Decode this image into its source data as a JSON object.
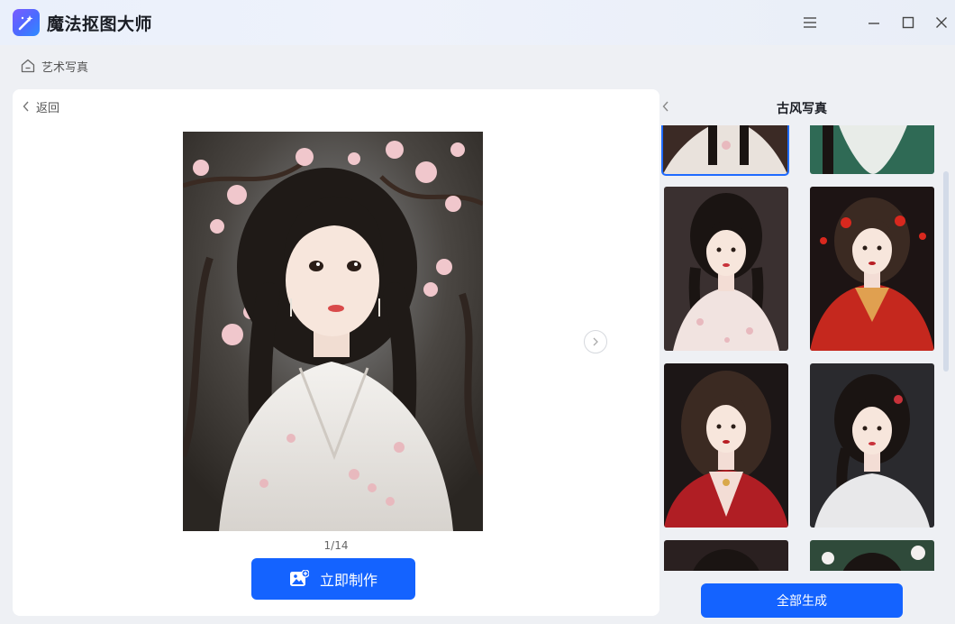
{
  "app": {
    "title": "魔法抠图大师"
  },
  "breadcrumb": {
    "label": "艺术写真"
  },
  "left": {
    "back_label": "返回",
    "page_indicator": "1/14",
    "make_button_label": "立即制作"
  },
  "right": {
    "title": "古风写真",
    "generate_all_label": "全部生成"
  },
  "gallery": {
    "items": [
      {
        "name": "portrait-1",
        "palette": [
          "#3b2a25",
          "#e9e2dc",
          "#1a1412"
        ]
      },
      {
        "name": "portrait-2",
        "palette": [
          "#2f6a55",
          "#e8ece8",
          "#1a1412"
        ]
      },
      {
        "name": "portrait-3",
        "palette": [
          "#3a3030",
          "#f1e3e0",
          "#1a1412"
        ]
      },
      {
        "name": "portrait-4",
        "palette": [
          "#1d1414",
          "#c5281e",
          "#1a1412"
        ]
      },
      {
        "name": "portrait-5",
        "palette": [
          "#1c1616",
          "#b01e24",
          "#3b2a22"
        ]
      },
      {
        "name": "portrait-6",
        "palette": [
          "#2a2a2e",
          "#e8e8ea",
          "#1a1412"
        ]
      },
      {
        "name": "portrait-7",
        "palette": [
          "#2a2020",
          "#f0dcd8",
          "#1a1412"
        ]
      },
      {
        "name": "portrait-8",
        "palette": [
          "#2f4a3a",
          "#f3f0ef",
          "#1a1412"
        ]
      }
    ]
  },
  "colors": {
    "accent": "#1463ff",
    "selected_outline": "#1f6bff"
  }
}
